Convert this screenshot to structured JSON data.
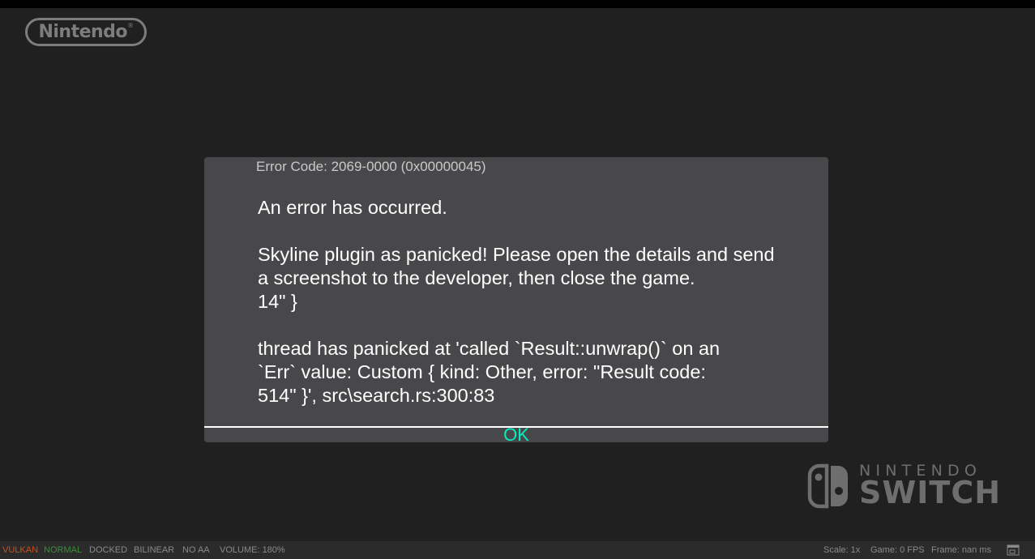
{
  "brand": {
    "nintendo_logo": "Nintendo",
    "switch_logo_top": "NINTENDO",
    "switch_logo_bottom": "SWITCH"
  },
  "dialog": {
    "error_code": "Error Code: 2069-0000 (0x00000045)",
    "lines": [
      "An error has occurred.",
      "",
      "Skyline plugin as panicked! Please open the details and send",
      "a screenshot to the developer, then close the game.",
      "14\" }",
      "",
      "thread has panicked at 'called `Result::unwrap()` on an",
      "`Err` value: Custom { kind: Other, error: \"Result code:",
      "514\" }', src\\search.rs:300:83"
    ],
    "ok_label": "OK",
    "ok_color": "#00f0c0"
  },
  "status_bar": {
    "renderer": "VULKAN",
    "speed": "NORMAL",
    "dock_mode": "DOCKED",
    "filter": "BILINEAR",
    "aa": "NO AA",
    "volume": "VOLUME: 180%",
    "scale": "Scale: 1x",
    "game_fps": "Game: 0 FPS",
    "frame_time": "Frame: nan ms",
    "renderer_color": "#c8501e",
    "speed_color": "#3e8a3e"
  }
}
